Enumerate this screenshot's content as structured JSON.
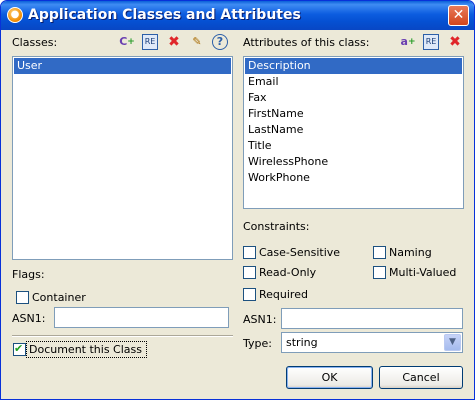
{
  "window": {
    "title": "Application Classes and Attributes"
  },
  "classes": {
    "label": "Classes:",
    "items": [
      "User"
    ],
    "selected": "User",
    "toolbar": [
      "add-class-icon",
      "rename-icon",
      "delete-icon",
      "edit-properties-icon",
      "help-icon"
    ]
  },
  "flags": {
    "label": "Flags:",
    "container_label": "Container",
    "container_checked": false,
    "asn1_label": "ASN1:",
    "asn1_value": "",
    "document_label": "Document this Class",
    "document_checked": true
  },
  "attributes": {
    "label": "Attributes of this class:",
    "items": [
      "Description",
      "Email",
      "Fax",
      "FirstName",
      "LastName",
      "Title",
      "WirelessPhone",
      "WorkPhone"
    ],
    "selected": "Description",
    "toolbar": [
      "add-attribute-icon",
      "rename-icon",
      "delete-icon"
    ]
  },
  "constraints": {
    "label": "Constraints:",
    "case_sensitive": "Case-Sensitive",
    "naming": "Naming",
    "read_only": "Read-Only",
    "multi_valued": "Multi-Valued",
    "required": "Required",
    "asn1_label": "ASN1:",
    "asn1_value": "",
    "type_label": "Type:",
    "type_value": "string"
  },
  "buttons": {
    "ok": "OK",
    "cancel": "Cancel"
  },
  "colors": {
    "selection": "#316ac5",
    "titlebar": "#0550d2",
    "dialog_bg": "#ece9d8"
  }
}
